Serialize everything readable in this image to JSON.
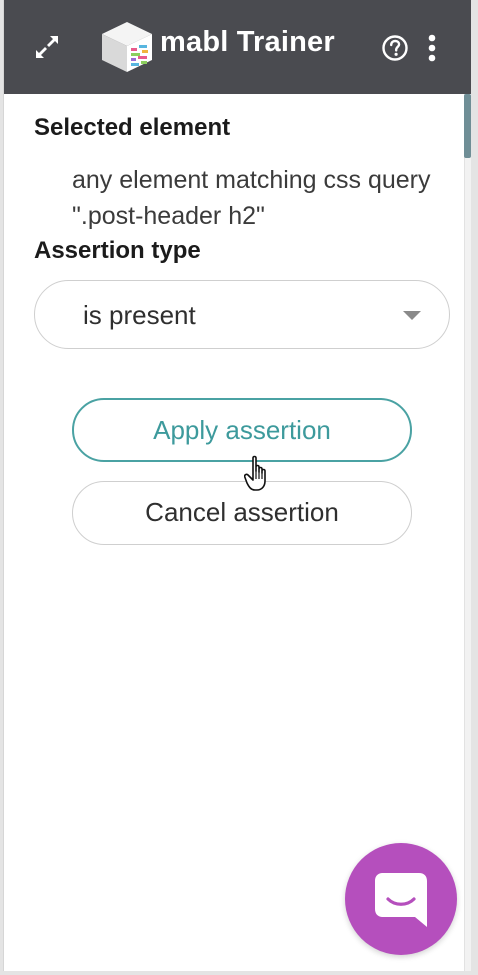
{
  "app": {
    "title": "mabl Trainer"
  },
  "header": {
    "expand_icon": "expand-arrows-icon",
    "logo_icon": "mabl-cube-logo",
    "help_icon": "question-circle-icon",
    "menu_icon": "vertical-ellipsis-icon",
    "background": "#4a4b50"
  },
  "selected_element": {
    "heading": "Selected element",
    "value": "any element matching css query \".post-header h2\""
  },
  "assertion_type": {
    "heading": "Assertion type",
    "selected": "is present"
  },
  "actions": {
    "apply_label": "Apply assertion",
    "cancel_label": "Cancel assertion"
  },
  "chat": {
    "icon": "chat-bubble-smile-icon",
    "color": "#b54fbd"
  },
  "colors": {
    "accent": "#4aa2a3"
  }
}
